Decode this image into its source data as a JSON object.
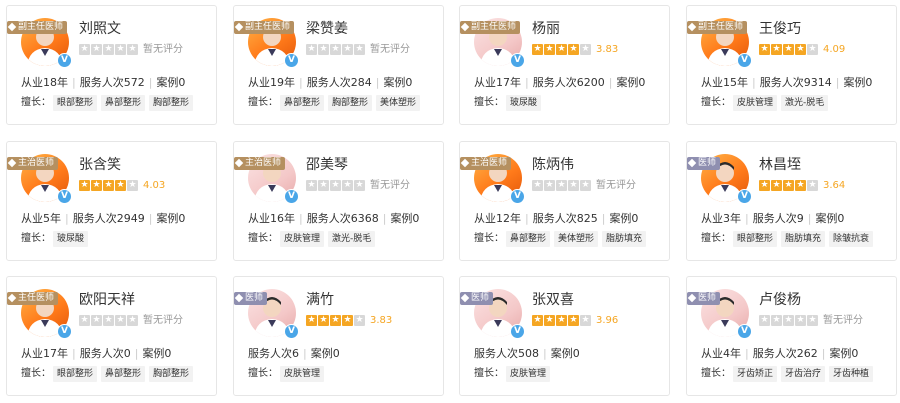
{
  "labels": {
    "years_suffix": "年",
    "years_prefix": "从业",
    "services_prefix": "服务人次",
    "cases_prefix": "案例",
    "skills_label": "擅长：",
    "verified_badge": "V",
    "no_rating": "暂无评分"
  },
  "colors": {
    "star_on": "#f5a623",
    "star_off": "#d8d8d8",
    "tag_zhuren": "#b59060",
    "tag_yishi": "#8f8fb0",
    "verified": "#4aa6e8"
  },
  "doctors": [
    {
      "name": "刘照文",
      "title": "副主任医师",
      "title_type": "zhuren",
      "stars": 0,
      "rating": "暂无评分",
      "years": "从业18年",
      "services": "服务人次572",
      "cases": "案例0",
      "skills": [
        "眼部整形",
        "鼻部整形",
        "胸部整形"
      ],
      "avatar": "orange"
    },
    {
      "name": "梁赞姜",
      "title": "副主任医师",
      "title_type": "zhuren",
      "stars": 0,
      "rating": "暂无评分",
      "years": "从业19年",
      "services": "服务人次284",
      "cases": "案例0",
      "skills": [
        "鼻部整形",
        "胸部整形",
        "美体塑形"
      ],
      "avatar": "orange"
    },
    {
      "name": "杨丽",
      "title": "副主任医师",
      "title_type": "zhuren",
      "stars": 3.5,
      "rating": "3.83",
      "years": "从业17年",
      "services": "服务人次6200",
      "cases": "案例0",
      "skills": [
        "玻尿酸"
      ],
      "avatar": "pink"
    },
    {
      "name": "王俊巧",
      "title": "副主任医师",
      "title_type": "zhuren",
      "stars": 4,
      "rating": "4.09",
      "years": "从业15年",
      "services": "服务人次9314",
      "cases": "案例0",
      "skills": [
        "皮肤管理",
        "激光-脱毛"
      ],
      "avatar": "orange"
    },
    {
      "name": "张含笑",
      "title": "主治医师",
      "title_type": "zhuren",
      "stars": 4,
      "rating": "4.03",
      "years": "从业5年",
      "services": "服务人次2949",
      "cases": "案例0",
      "skills": [
        "玻尿酸"
      ],
      "avatar": "orange"
    },
    {
      "name": "邵美琴",
      "title": "主治医师",
      "title_type": "zhuren",
      "stars": 0,
      "rating": "暂无评分",
      "years": "从业16年",
      "services": "服务人次6368",
      "cases": "案例0",
      "skills": [
        "皮肤管理",
        "激光-脱毛"
      ],
      "avatar": "pink"
    },
    {
      "name": "陈炳伟",
      "title": "主治医师",
      "title_type": "zhuren",
      "stars": 0,
      "rating": "暂无评分",
      "years": "从业12年",
      "services": "服务人次825",
      "cases": "案例0",
      "skills": [
        "鼻部整形",
        "美体塑形",
        "脂肪填充"
      ],
      "avatar": "orange"
    },
    {
      "name": "林昌垤",
      "title": "医师",
      "title_type": "yishi",
      "stars": 3.5,
      "rating": "3.64",
      "years": "从业3年",
      "services": "服务人次9",
      "cases": "案例0",
      "skills": [
        "眼部整形",
        "脂肪填充",
        "除皱抗衰"
      ],
      "avatar": "orange"
    },
    {
      "name": "欧阳天祥",
      "title": "主任医师",
      "title_type": "zhuren",
      "stars": 0,
      "rating": "暂无评分",
      "years": "从业17年",
      "services": "服务人次0",
      "cases": "案例0",
      "skills": [
        "眼部整形",
        "鼻部整形",
        "胸部整形"
      ],
      "avatar": "orange"
    },
    {
      "name": "满竹",
      "title": "医师",
      "title_type": "yishi",
      "stars": 3.5,
      "rating": "3.83",
      "years": "",
      "services": "服务人次6",
      "cases": "案例0",
      "skills": [
        "皮肤管理"
      ],
      "avatar": "pink"
    },
    {
      "name": "张双喜",
      "title": "医师",
      "title_type": "yishi",
      "stars": 4,
      "rating": "3.96",
      "years": "",
      "services": "服务人次508",
      "cases": "案例0",
      "skills": [
        "皮肤管理"
      ],
      "avatar": "pink"
    },
    {
      "name": "卢俊杨",
      "title": "医师",
      "title_type": "yishi",
      "stars": 0,
      "rating": "暂无评分",
      "years": "从业4年",
      "services": "服务人次262",
      "cases": "案例0",
      "skills": [
        "牙齿矫正",
        "牙齿治疗",
        "牙齿种植"
      ],
      "avatar": "pink"
    }
  ]
}
